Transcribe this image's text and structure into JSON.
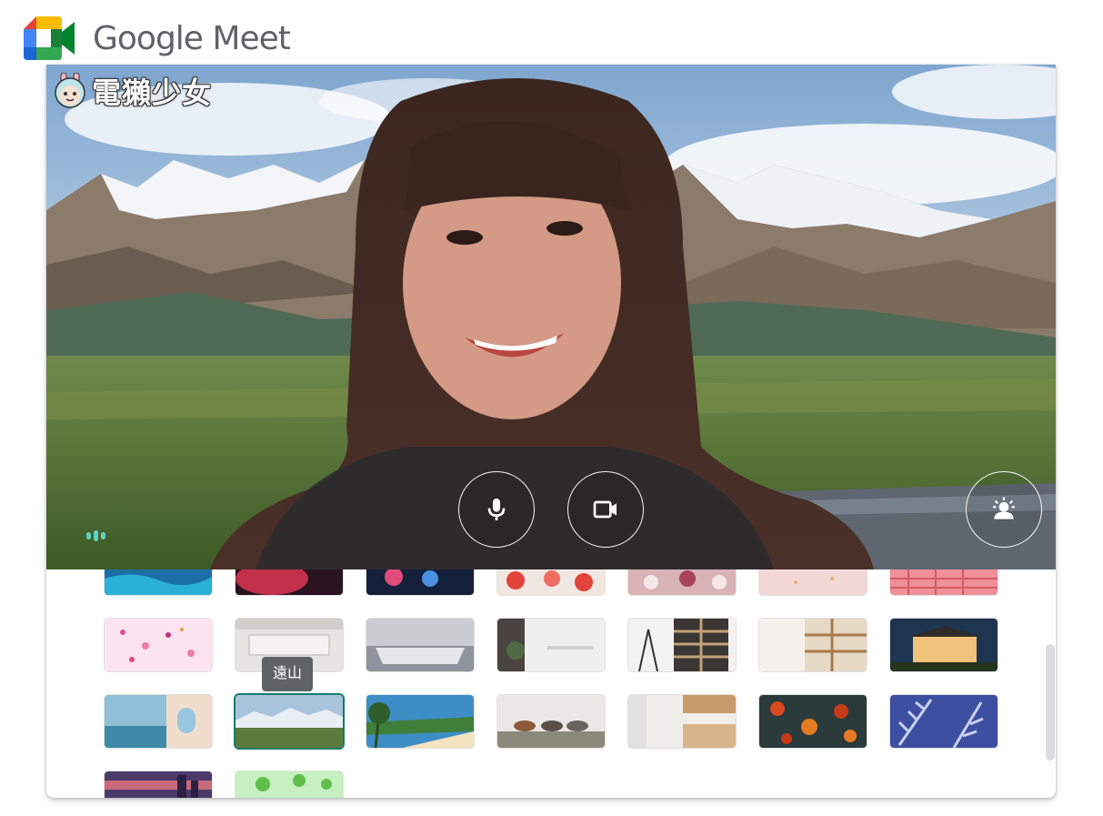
{
  "brand": {
    "name": "Google Meet",
    "logo": "google-meet-logo"
  },
  "watermark": {
    "text": "電獺少女",
    "icon": "otter-mascot"
  },
  "preview": {
    "background": "遠山",
    "controls": [
      {
        "name": "microphone-button",
        "icon": "microphone-icon"
      },
      {
        "name": "camera-button",
        "icon": "video-camera-icon"
      },
      {
        "name": "effects-button",
        "icon": "person-sparkle-icon"
      }
    ],
    "audio_indicator": "audio-level-icon"
  },
  "backgrounds": {
    "tooltip": "遠山",
    "selected": "遠山",
    "items": [
      {
        "id": "ocean-water"
      },
      {
        "id": "nebula"
      },
      {
        "id": "fireworks"
      },
      {
        "id": "flowers-red"
      },
      {
        "id": "flowers-pink"
      },
      {
        "id": "pink-sparkle"
      },
      {
        "id": "pink-pattern"
      },
      {
        "id": "confetti"
      },
      {
        "id": "white-room"
      },
      {
        "id": "bedroom"
      },
      {
        "id": "desk-room"
      },
      {
        "id": "bookshelf"
      },
      {
        "id": "shelf-room"
      },
      {
        "id": "cabin-night"
      },
      {
        "id": "seaside-arch"
      },
      {
        "id": "mountains"
      },
      {
        "id": "beach-palms"
      },
      {
        "id": "horses"
      },
      {
        "id": "kitchen"
      },
      {
        "id": "autumn-leaves"
      },
      {
        "id": "fern-leaves"
      },
      {
        "id": "city-sunset"
      },
      {
        "id": "green-cartoon"
      }
    ]
  },
  "colors": {
    "accent": "#137a6b",
    "indicator": "#5ed3c3",
    "tooltip_bg": "#5f6368"
  }
}
